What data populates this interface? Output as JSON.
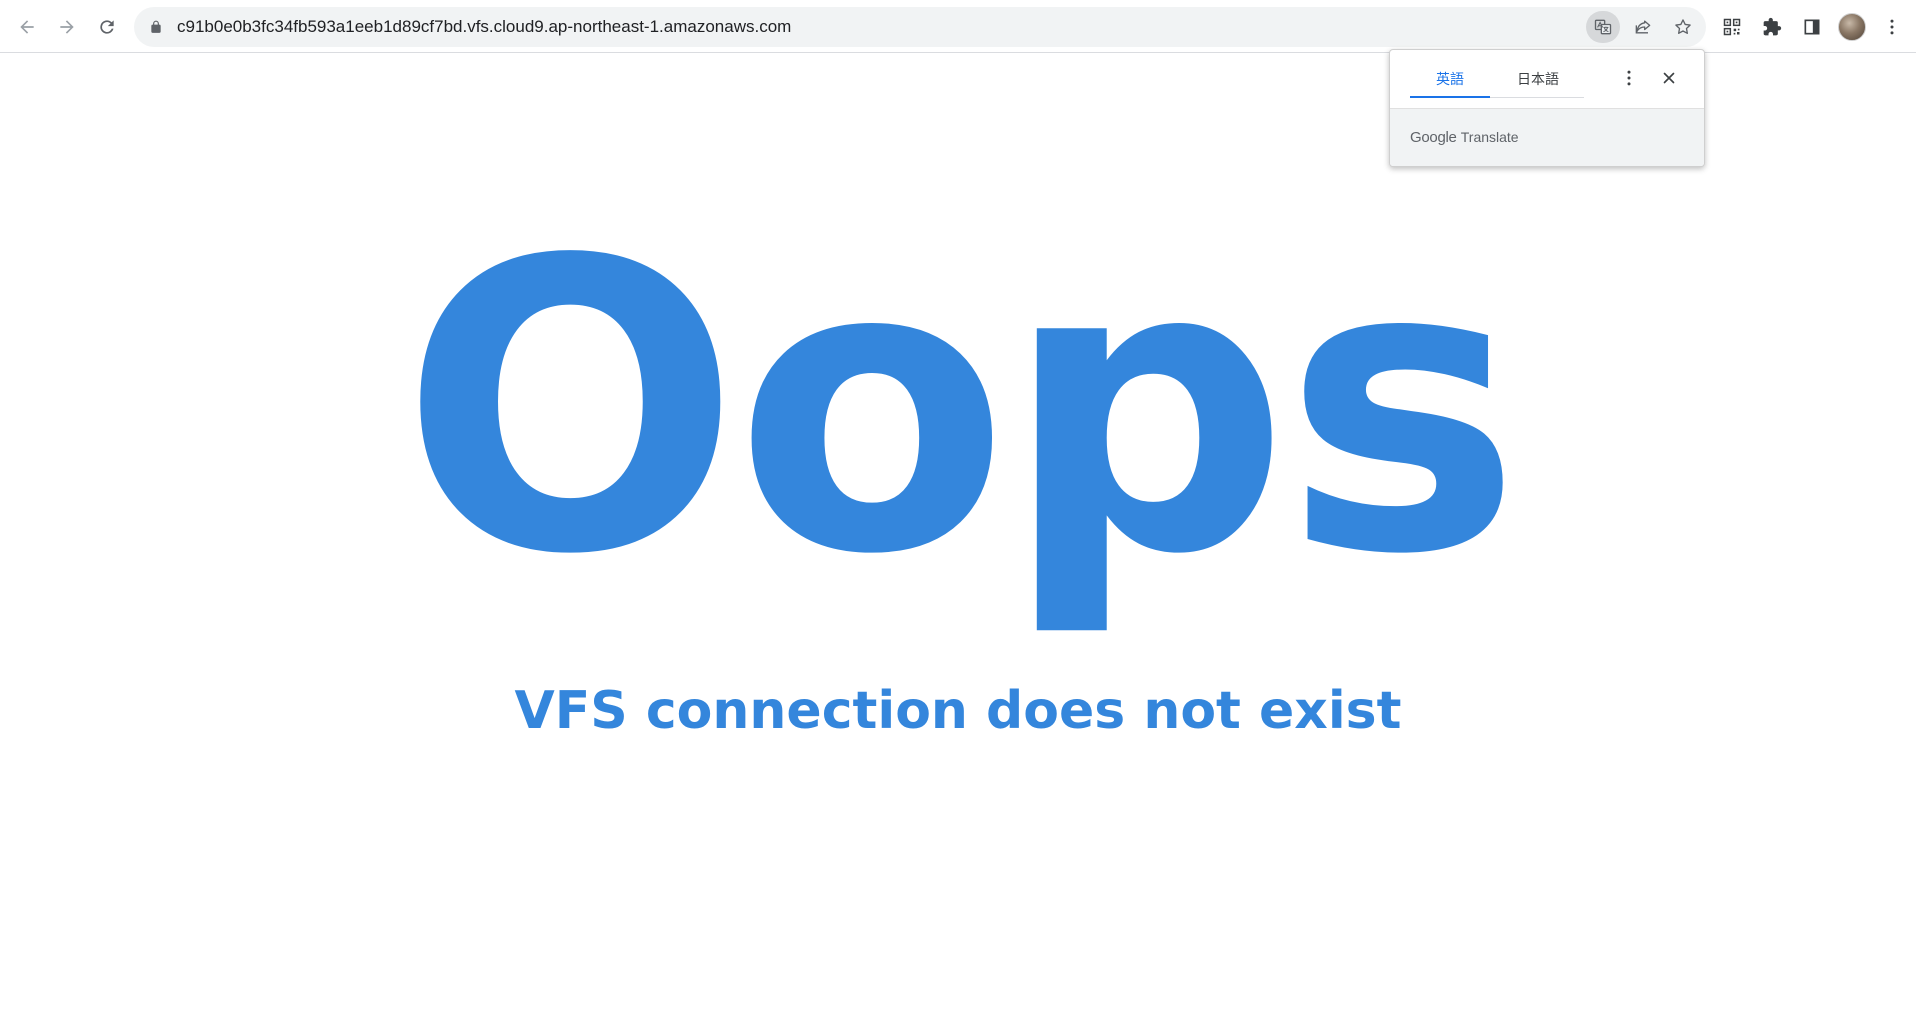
{
  "browser": {
    "url": "c91b0e0b3fc34fb593a1eeb1d89cf7bd.vfs.cloud9.ap-northeast-1.amazonaws.com",
    "icons": {
      "back": "back-arrow-icon",
      "forward": "forward-arrow-icon",
      "reload": "reload-icon",
      "lock": "lock-icon",
      "translate": "translate-icon",
      "share": "share-icon",
      "bookmark": "star-icon",
      "qr": "qr-code-icon",
      "extensions": "puzzle-icon",
      "side_panel": "side-panel-icon",
      "menu": "kebab-menu-icon"
    }
  },
  "translate_popup": {
    "tabs": [
      {
        "label": "英語",
        "selected": true
      },
      {
        "label": "日本語",
        "selected": false
      }
    ],
    "brand_google": "Google",
    "brand_translate": "Translate"
  },
  "page": {
    "heading": "Oops",
    "message": "VFS connection does not exist",
    "accent_color": "#3486dc"
  }
}
